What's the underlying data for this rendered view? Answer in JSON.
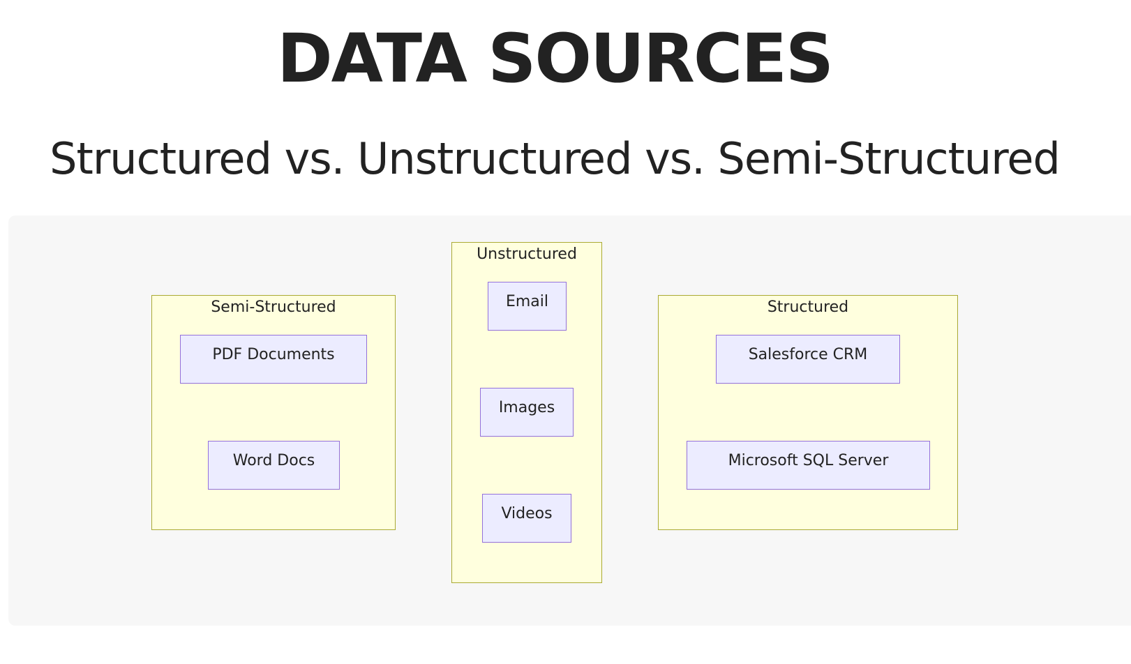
{
  "header": {
    "title": "DATA SOURCES",
    "subtitle": "Structured vs. Unstructured vs. Semi-Structured"
  },
  "diagram": {
    "colors": {
      "canvas_background": "#f7f7f7",
      "group_fill": "#ffffde",
      "group_border": "#aaaa33",
      "node_fill": "#ececff",
      "node_border": "#9370db"
    },
    "groups": {
      "semi_structured": {
        "label": "Semi-Structured",
        "nodes": [
          "PDF Documents",
          "Word Docs"
        ]
      },
      "unstructured": {
        "label": "Unstructured",
        "nodes": [
          "Email",
          "Images",
          "Videos"
        ]
      },
      "structured": {
        "label": "Structured",
        "nodes": [
          "Salesforce CRM",
          "Microsoft SQL Server"
        ]
      }
    }
  }
}
